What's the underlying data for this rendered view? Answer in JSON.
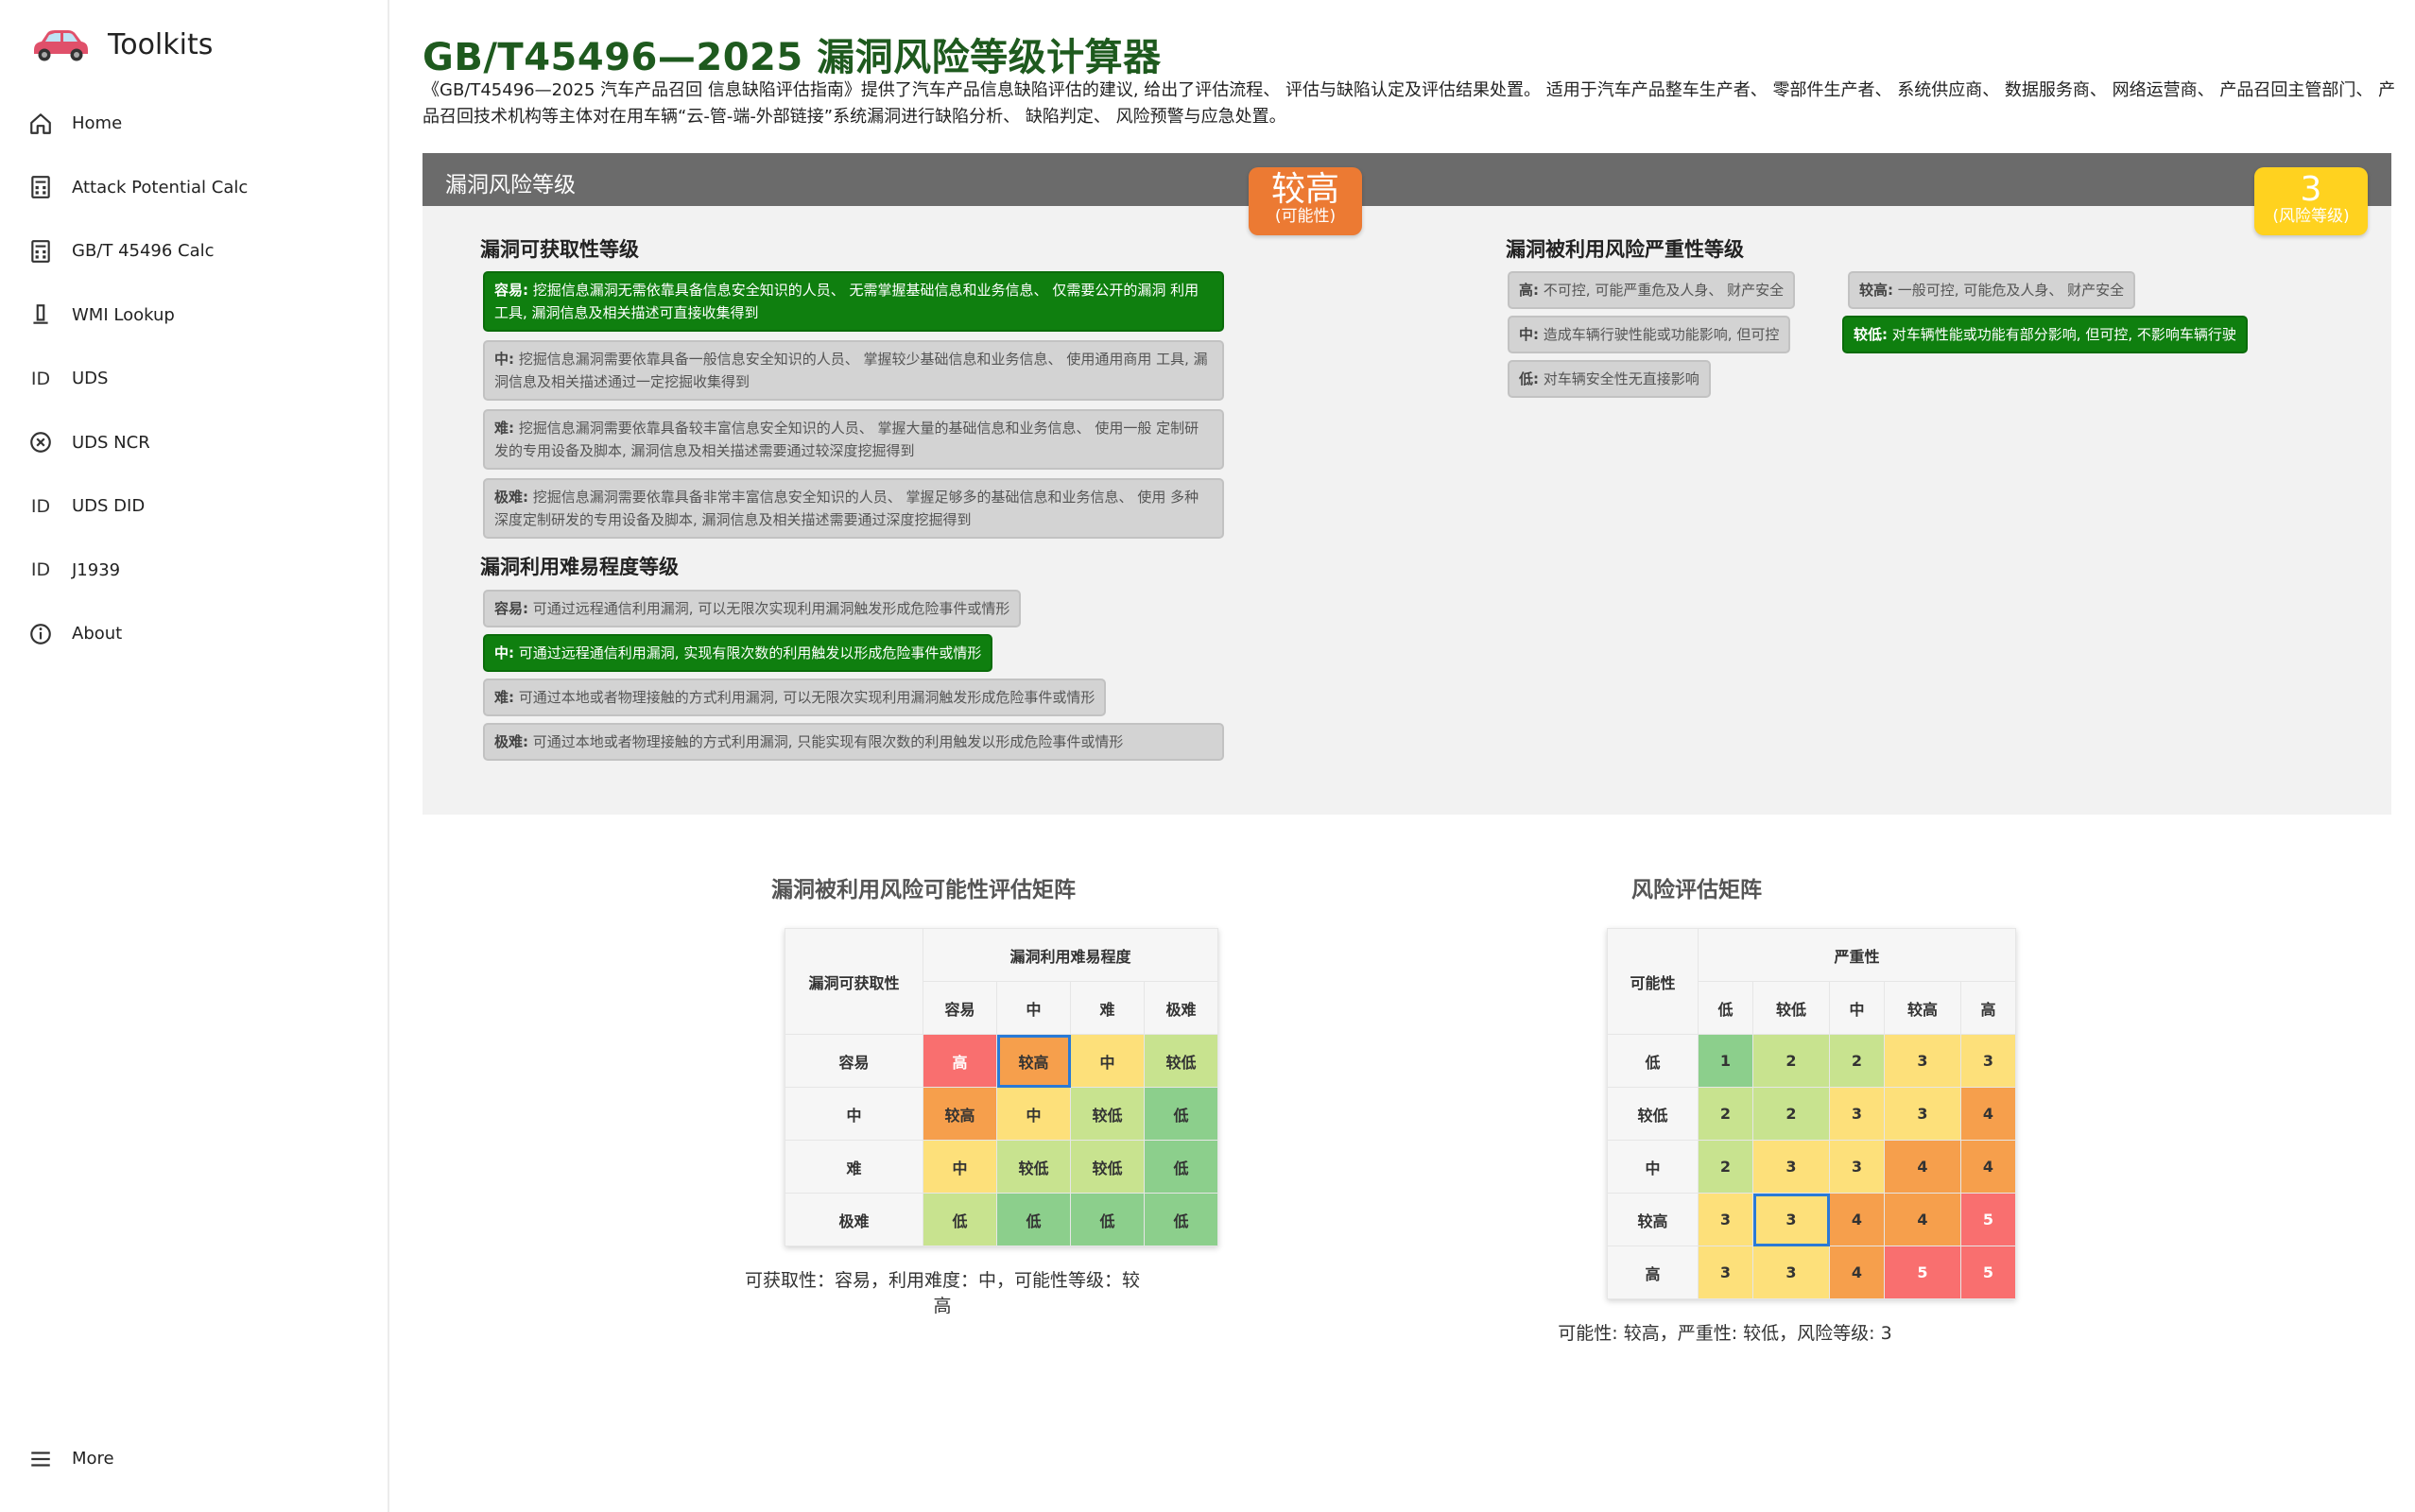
{
  "sidebar": {
    "brand": "Toolkits",
    "items": [
      {
        "label": "Home",
        "icon": "home-icon"
      },
      {
        "label": "Attack Potential Calc",
        "icon": "calculator-icon"
      },
      {
        "label": "GB/T 45496 Calc",
        "icon": "calculator-icon"
      },
      {
        "label": "WMI Lookup",
        "icon": "key-icon"
      },
      {
        "label": "UDS",
        "icon": "id-icon"
      },
      {
        "label": "UDS NCR",
        "icon": "cancel-circle-icon"
      },
      {
        "label": "UDS DID",
        "icon": "id-icon"
      },
      {
        "label": "J1939",
        "icon": "id-icon"
      },
      {
        "label": "About",
        "icon": "info-icon"
      }
    ],
    "more": "More"
  },
  "page": {
    "title": "GB/T45496—2025 漏洞风险等级计算器",
    "description": "《GB/T45496—2025 汽车产品召回 信息缺陷评估指南》提供了汽车产品信息缺陷评估的建议, 给出了评估流程、 评估与缺陷认定及评估结果处置。 适用于汽车产品整车生产者、 零部件生产者、 系统供应商、 数据服务商、 网络运营商、 产品召回主管部门、 产品召回技术机构等主体对在用车辆“云-管-端-外部链接”系统漏洞进行缺陷分析、 缺陷判定、 风险预警与应急处置。"
  },
  "panel": {
    "title": "漏洞风险等级",
    "possibility_badge": {
      "value": "较高",
      "label": "(可能性)"
    },
    "risk_badge": {
      "value": "3",
      "label": "(风险等级)"
    }
  },
  "acquisition": {
    "heading": "漏洞可获取性等级",
    "options": [
      {
        "key": "容易:",
        "text": "挖掘信息漏洞无需依靠具备信息安全知识的人员、 无需掌握基础信息和业务信息、 仅需要公开的漏洞 利用工具, 漏洞信息及相关描述可直接收集得到",
        "selected": true
      },
      {
        "key": "中:",
        "text": "挖掘信息漏洞需要依靠具备一般信息安全知识的人员、 掌握较少基础信息和业务信息、 使用通用商用 工具, 漏洞信息及相关描述通过一定挖掘收集得到",
        "selected": false
      },
      {
        "key": "难:",
        "text": "挖掘信息漏洞需要依靠具备较丰富信息安全知识的人员、 掌握大量的基础信息和业务信息、 使用一般 定制研发的专用设备及脚本, 漏洞信息及相关描述需要通过较深度挖掘得到",
        "selected": false
      },
      {
        "key": "极难:",
        "text": "挖掘信息漏洞需要依靠具备非常丰富信息安全知识的人员、 掌握足够多的基础信息和业务信息、 使用 多种深度定制研发的专用设备及脚本, 漏洞信息及相关描述需要通过深度挖掘得到",
        "selected": false
      }
    ]
  },
  "exploit": {
    "heading": "漏洞利用难易程度等级",
    "options": [
      {
        "key": "容易:",
        "text": "可通过远程通信利用漏洞, 可以无限次实现利用漏洞触发形成危险事件或情形",
        "selected": false
      },
      {
        "key": "中:",
        "text": "可通过远程通信利用漏洞, 实现有限次数的利用触发以形成危险事件或情形",
        "selected": true
      },
      {
        "key": "难:",
        "text": "可通过本地或者物理接触的方式利用漏洞, 可以无限次实现利用漏洞触发形成危险事件或情形",
        "selected": false
      },
      {
        "key": "极难:",
        "text": "可通过本地或者物理接触的方式利用漏洞, 只能实现有限次数的利用触发以形成危险事件或情形",
        "selected": false
      }
    ]
  },
  "severity": {
    "heading": "漏洞被利用风险严重性等级",
    "options": [
      {
        "key": "高:",
        "text": "不可控, 可能严重危及人身、 财产安全",
        "selected": false
      },
      {
        "key": "较高:",
        "text": "一般可控, 可能危及人身、 财产安全",
        "selected": false
      },
      {
        "key": "中:",
        "text": "造成车辆行驶性能或功能影响, 但可控",
        "selected": false
      },
      {
        "key": "较低:",
        "text": "对车辆性能或功能有部分影响, 但可控, 不影响车辆行驶",
        "selected": true
      },
      {
        "key": "低:",
        "text": "对车辆安全性无直接影响",
        "selected": false
      }
    ]
  },
  "matrix1": {
    "title": "漏洞被利用风险可能性评估矩阵",
    "corner": "漏洞可获取性",
    "col_group": "漏洞利用难易程度",
    "cols": [
      "容易",
      "中",
      "难",
      "极难"
    ],
    "rows": [
      {
        "label": "容易",
        "cells": [
          "高",
          "较高",
          "中",
          "较低"
        ]
      },
      {
        "label": "中",
        "cells": [
          "较高",
          "中",
          "较低",
          "低"
        ]
      },
      {
        "label": "难",
        "cells": [
          "中",
          "较低",
          "较低",
          "低"
        ]
      },
      {
        "label": "极难",
        "cells": [
          "低",
          "低",
          "低",
          "低"
        ]
      }
    ],
    "caption": "可获取性：容易，利用难度：中，可能性等级：较高"
  },
  "matrix2": {
    "title": "风险评估矩阵",
    "corner": "可能性",
    "col_group": "严重性",
    "cols": [
      "低",
      "较低",
      "中",
      "较高",
      "高"
    ],
    "rows": [
      {
        "label": "低",
        "cells": [
          "1",
          "2",
          "2",
          "3",
          "3"
        ]
      },
      {
        "label": "较低",
        "cells": [
          "2",
          "2",
          "3",
          "3",
          "4"
        ]
      },
      {
        "label": "中",
        "cells": [
          "2",
          "3",
          "3",
          "4",
          "4"
        ]
      },
      {
        "label": "较高",
        "cells": [
          "3",
          "3",
          "4",
          "4",
          "5"
        ]
      },
      {
        "label": "高",
        "cells": [
          "3",
          "3",
          "4",
          "5",
          "5"
        ]
      }
    ],
    "caption": "可能性: 较高，严重性: 较低，风险等级: 3"
  },
  "colors": {
    "title_green": "#1e5a1e",
    "selected_green": "#0f7f0f",
    "possibility_orange": "#ec7a33",
    "risk_yellow": "#ffd21f",
    "highlight_blue": "#2a7ad6"
  }
}
